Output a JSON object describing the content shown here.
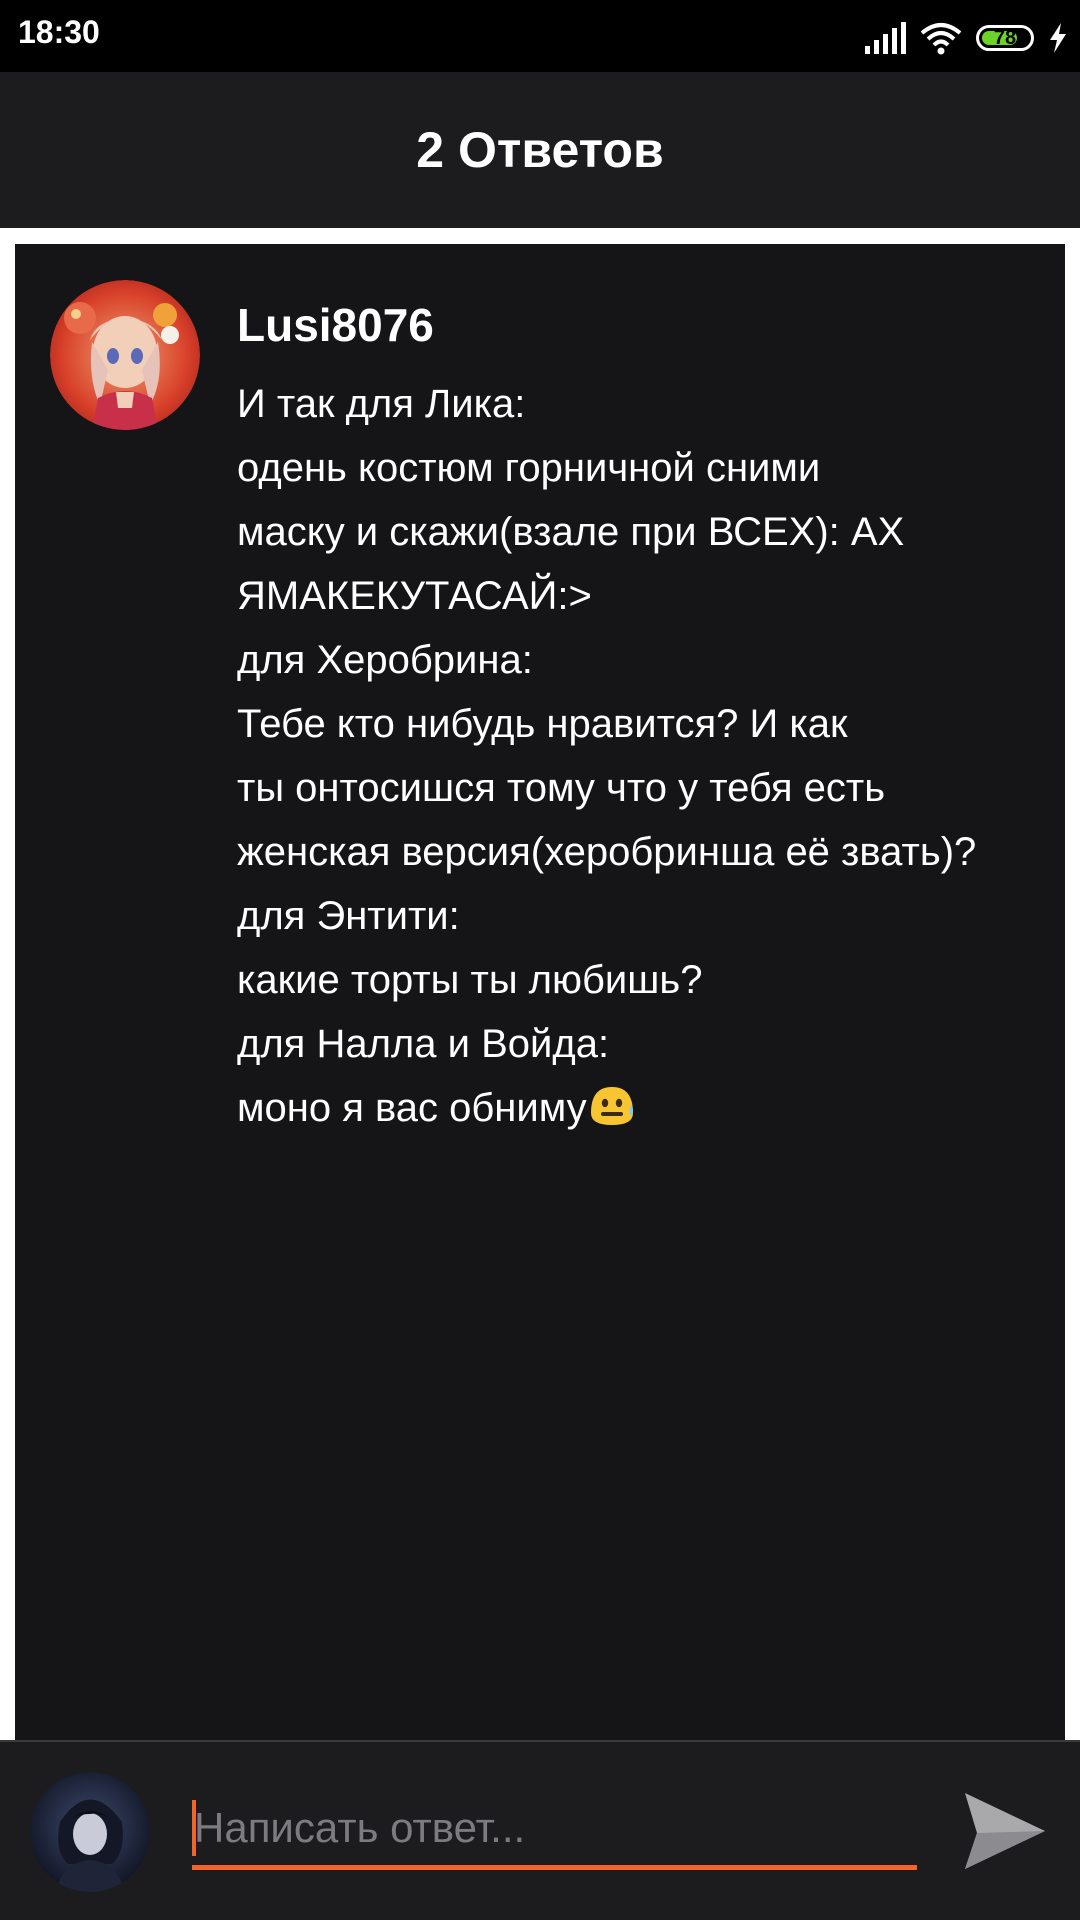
{
  "status_bar": {
    "time": "18:30",
    "battery_level": "78",
    "icons": [
      "signal-icon",
      "wifi-icon",
      "battery-icon",
      "charging-icon"
    ]
  },
  "header": {
    "title": "2 Ответов"
  },
  "post": {
    "author": "Lusi8076",
    "lines": [
      "И так для Лика:",
      "одень костюм горничной сними",
      "маску и скажи(взале при ВСЕХ): АХ",
      "ЯМАКЕКУТАСАЙ:>",
      "для Херобрина:",
      "Тебе кто нибудь нравится? И как",
      "ты онтосишся тому что у тебя есть",
      "женская версия(херобринша её звать)?",
      "для Энтити:",
      "какие  торты ты любишь?",
      "для Налла и Войда:",
      "моно я вас обниму"
    ],
    "emoji": "grimacing-face-emoji"
  },
  "reply": {
    "placeholder": "Написать ответ...",
    "value": "",
    "send_icon": "send-icon"
  },
  "colors": {
    "status_bar": "#000000",
    "header": "#1c1b1e",
    "card": "#151417",
    "accent": "#f0652a",
    "placeholder": "#7c7b80",
    "battery": "#6bd32a"
  }
}
